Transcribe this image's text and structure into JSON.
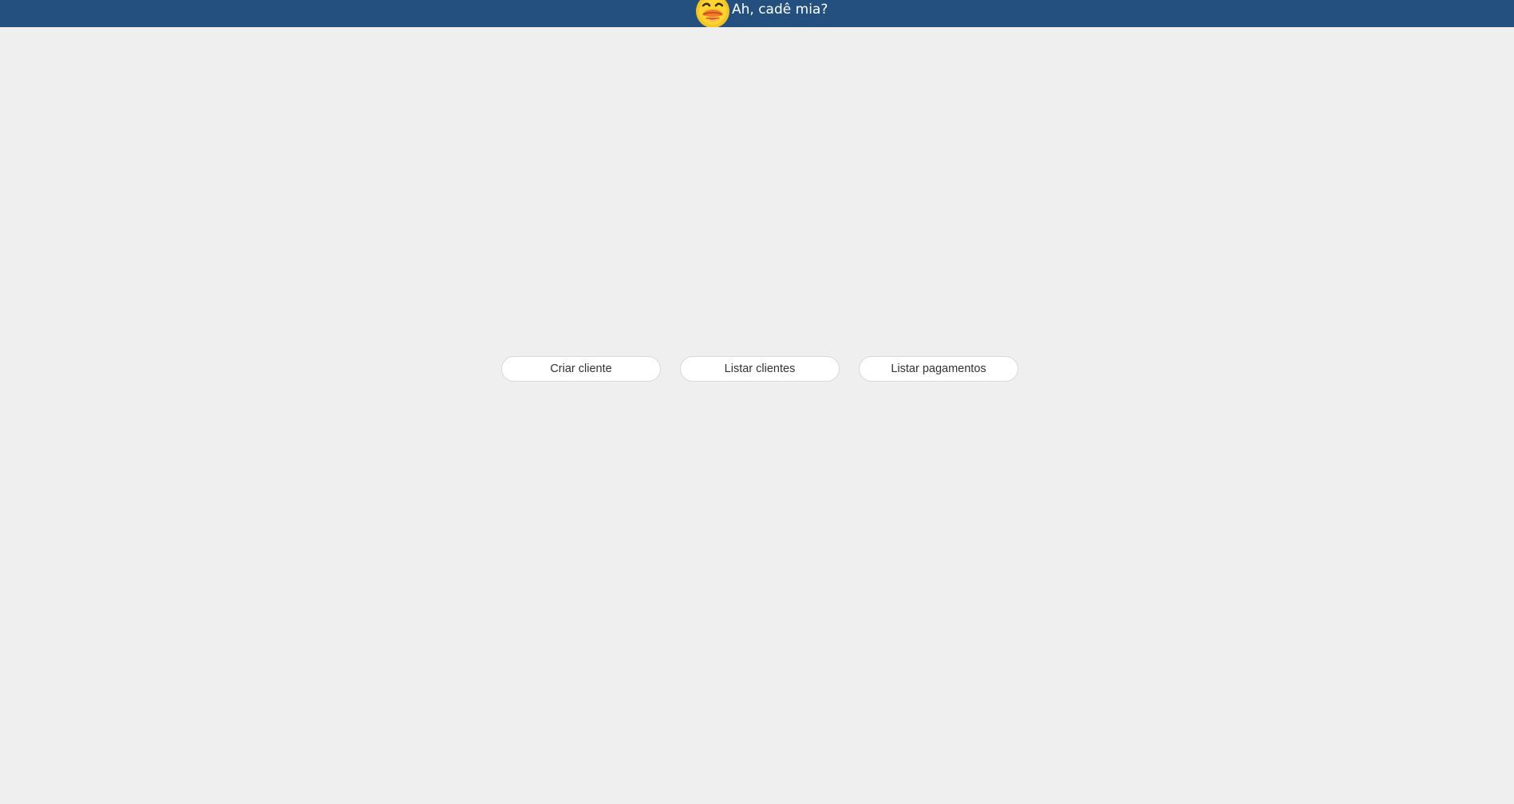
{
  "header": {
    "title": "Ah, cadê mia?",
    "logo_icon": "duck-face-icon",
    "background_color": "#23507f"
  },
  "actions": [
    {
      "label": "Criar cliente"
    },
    {
      "label": "Listar clientes"
    },
    {
      "label": "Listar pagamentos"
    }
  ],
  "page": {
    "background_color": "#efefef"
  }
}
